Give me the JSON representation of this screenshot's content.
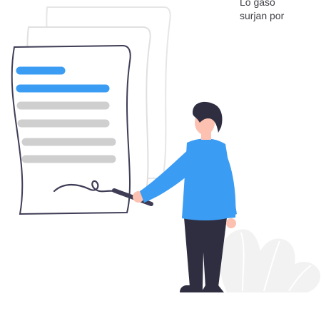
{
  "caption": {
    "line1": "Lo   gaso",
    "line2": "surjan por"
  },
  "illustration": {
    "icon": "contract-signing-illustration",
    "accent_color": "#3b9cf4",
    "line_color": "#cfcfcf",
    "pants_color": "#2f2e41",
    "skin_color": "#fcc1b0",
    "plant_color": "#f2f2f2"
  }
}
